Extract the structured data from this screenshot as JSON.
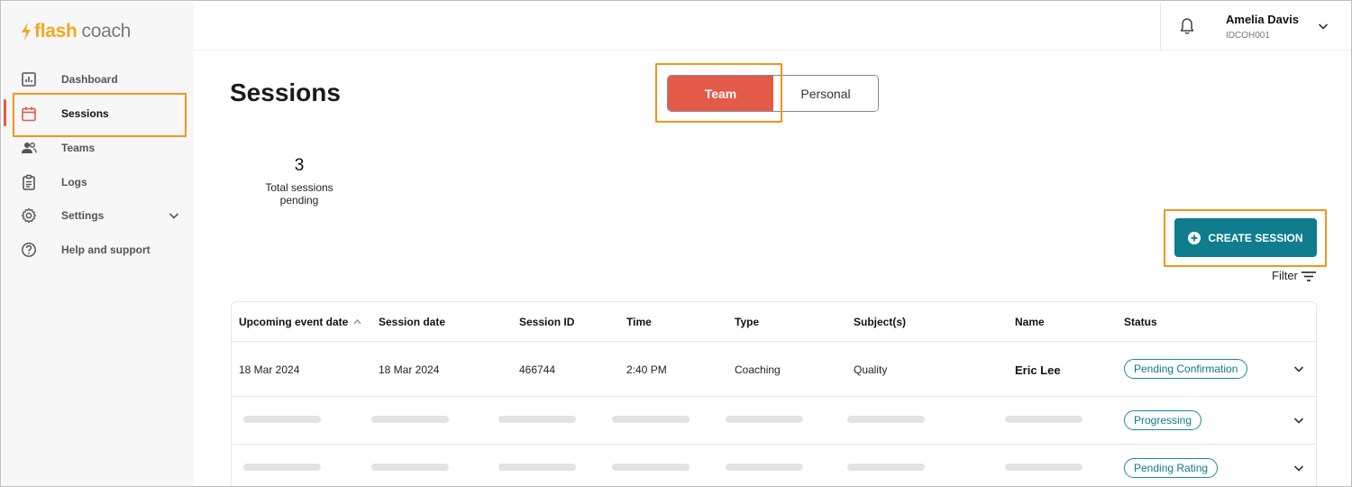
{
  "app": {
    "logo_primary": "flash",
    "logo_secondary": "coach",
    "brand_color": "#f5a623",
    "accent_color": "#e35a48",
    "primary_button_color": "#0f7d8e",
    "highlight_color": "#f7941d"
  },
  "sidebar": {
    "items": [
      {
        "label": "Dashboard",
        "icon": "chart-icon"
      },
      {
        "label": "Sessions",
        "icon": "calendar-icon",
        "active": true
      },
      {
        "label": "Teams",
        "icon": "people-icon"
      },
      {
        "label": "Logs",
        "icon": "clipboard-icon"
      },
      {
        "label": "Settings",
        "icon": "gear-icon",
        "expandable": true
      },
      {
        "label": "Help and support",
        "icon": "help-icon"
      }
    ]
  },
  "header": {
    "notification_icon": "bell-icon",
    "user_name": "Amelia Davis",
    "user_id": "IDCOH001"
  },
  "main": {
    "title": "Sessions",
    "toggle": {
      "team_label": "Team",
      "personal_label": "Personal",
      "selected": "Team"
    },
    "stats": {
      "pending_count": "3",
      "pending_label": "Total sessions pending"
    },
    "create_button_label": "CREATE SESSION",
    "filter_label": "Filter"
  },
  "table": {
    "columns": [
      "Upcoming event date",
      "Session date",
      "Session ID",
      "Time",
      "Type",
      "Subject(s)",
      "Name",
      "Status"
    ],
    "sort_column": "Upcoming event date",
    "rows": [
      {
        "upcoming_event_date": "18 Mar 2024",
        "session_date": "18 Mar 2024",
        "session_id": "466744",
        "time": "2:40 PM",
        "type": "Coaching",
        "subjects": "Quality",
        "name": "Eric Lee",
        "status": "Pending Confirmation"
      },
      {
        "loading": true,
        "status": "Progressing"
      },
      {
        "loading": true,
        "status": "Pending Rating"
      }
    ]
  }
}
